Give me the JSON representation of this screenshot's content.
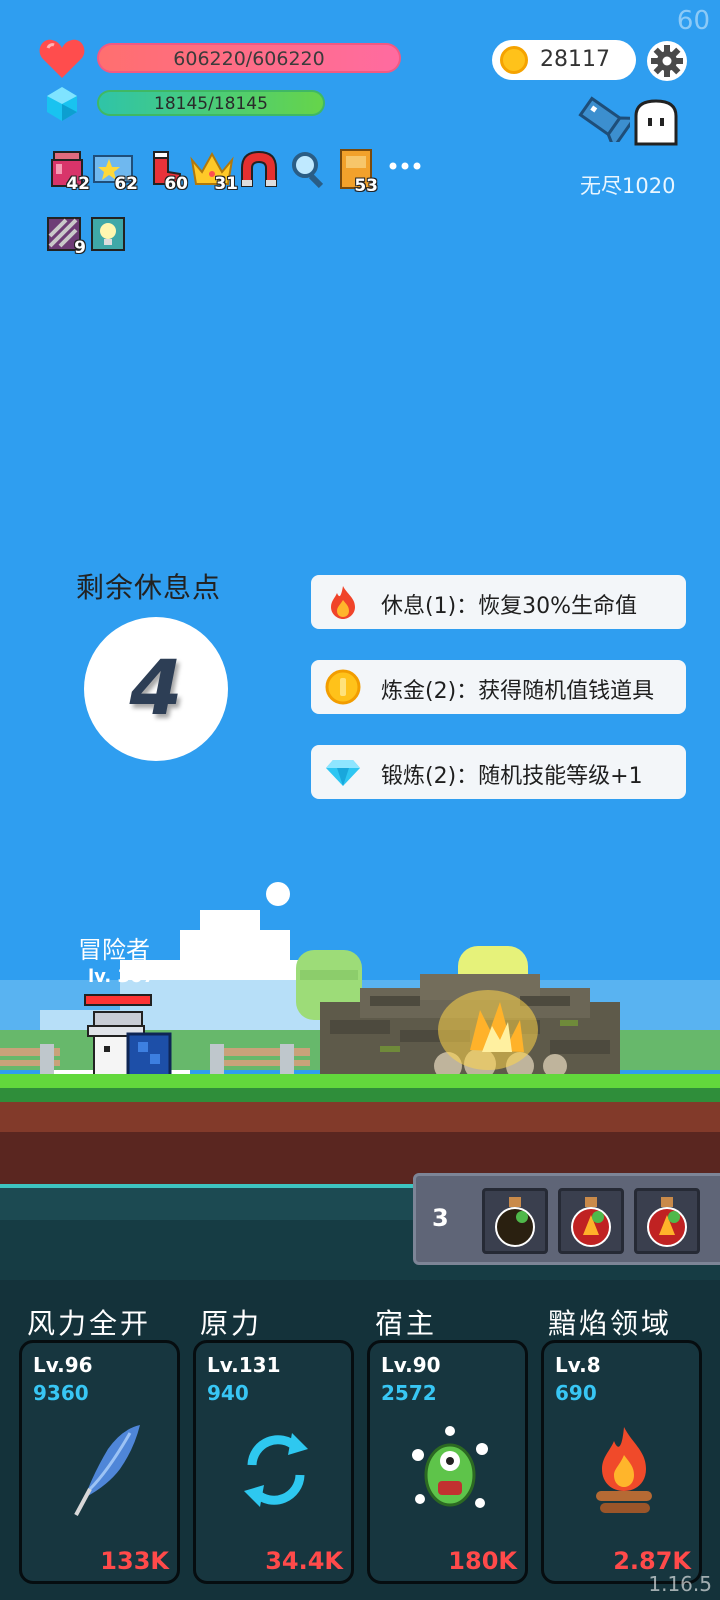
{
  "hud": {
    "fps": "60",
    "hp_text": "606220/606220",
    "hp_current": 606220,
    "hp_max": 606220,
    "mp_text": "18145/18145",
    "mp_current": 18145,
    "mp_max": 18145,
    "coins": "28117",
    "endless_label": "无尽1020"
  },
  "items": [
    {
      "icon": "jam-jar-icon",
      "count": "42"
    },
    {
      "icon": "star-card-icon",
      "count": "62"
    },
    {
      "icon": "red-boot-icon",
      "count": "60"
    },
    {
      "icon": "gold-crown-icon",
      "count": "31"
    },
    {
      "icon": "magnet-icon",
      "count": ""
    },
    {
      "icon": "magnifier-icon",
      "count": ""
    },
    {
      "icon": "book-icon",
      "count": "53"
    },
    {
      "icon": "more-icon",
      "count": ""
    },
    {
      "icon": "striped-scroll-icon",
      "count": "9"
    },
    {
      "icon": "light-bulb-icon",
      "count": ""
    }
  ],
  "rest": {
    "title": "剩余休息点",
    "points": "4",
    "options": [
      {
        "icon": "fire-icon",
        "label": "休息(1)：恢复30%生命值"
      },
      {
        "icon": "coin-icon",
        "label": "炼金(2)：获得随机值钱道具"
      },
      {
        "icon": "diamond-icon",
        "label": "锻炼(2)：随机技能等级+1"
      }
    ]
  },
  "hero": {
    "name": "冒险者",
    "level": "lv. 307"
  },
  "potions": {
    "count": "3",
    "slots": [
      "dark-potion-icon",
      "fire-potion-icon",
      "fire-potion-icon"
    ]
  },
  "skills": [
    {
      "name": "风力全开",
      "level": "Lv.96",
      "cost": "9360",
      "power": "133K",
      "icon": "feather-icon"
    },
    {
      "name": "原力",
      "level": "Lv.131",
      "cost": "940",
      "power": "34.4K",
      "icon": "cycle-arrows-icon"
    },
    {
      "name": "宿主",
      "level": "Lv.90",
      "cost": "2572",
      "power": "180K",
      "icon": "green-monster-icon"
    },
    {
      "name": "黯焰领域",
      "level": "Lv.8",
      "cost": "690",
      "power": "2.87K",
      "icon": "campfire-icon"
    }
  ],
  "version": "1.16.5",
  "colors": {
    "sky": "#2f9ef0",
    "hp": "#ff6b8a",
    "mp": "#4cc56a",
    "skill_panel": "#14323a",
    "skill_cost": "#38c6f4",
    "skill_power": "#ff4a4a"
  }
}
